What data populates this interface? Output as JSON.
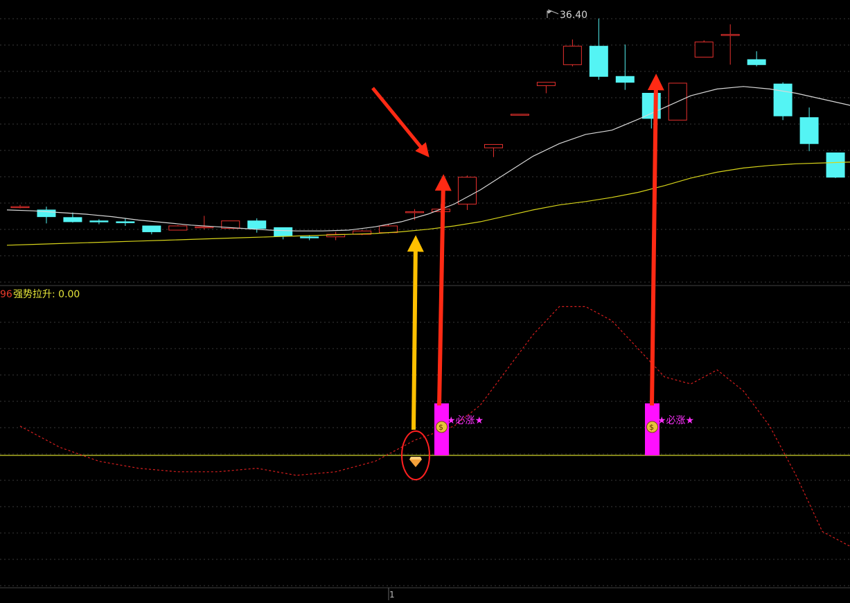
{
  "colors": {
    "background": "#000000",
    "up": "#e8312e",
    "down": "#54f4f4",
    "ma_fast": "#d8d8d8",
    "ma_slow": "#d7d41a",
    "indicator": "#d81e1e",
    "baseline": "#cfd22a",
    "signal": "#ff10ff",
    "arrow_red": "#ff2a14",
    "arrow_orange": "#ffc000",
    "grid": "#3a3a3a"
  },
  "top_panel": {
    "max_label": "36.40"
  },
  "bottom_panel": {
    "indicator_value": "96",
    "indicator_label": "强势拉升: 0.00"
  },
  "signal_label": "★必涨★",
  "axis_marker": "1",
  "chart_data": [
    {
      "type": "candlestick",
      "ylim": [
        20.5,
        37.5
      ],
      "max_annotation": 36.4,
      "candles": [
        {
          "o": 25.2,
          "h": 25.3,
          "l": 25.1,
          "c": 25.2
        },
        {
          "o": 25.0,
          "h": 25.2,
          "l": 24.2,
          "c": 24.6
        },
        {
          "o": 24.55,
          "h": 24.85,
          "l": 24.25,
          "c": 24.3
        },
        {
          "o": 24.35,
          "h": 24.45,
          "l": 24.15,
          "c": 24.3
        },
        {
          "o": 24.3,
          "h": 24.5,
          "l": 24.05,
          "c": 24.25
        },
        {
          "o": 24.05,
          "h": 24.05,
          "l": 23.55,
          "c": 23.7
        },
        {
          "o": 23.8,
          "h": 24.1,
          "l": 23.8,
          "c": 24.05
        },
        {
          "o": 23.95,
          "h": 24.65,
          "l": 23.85,
          "c": 24.0
        },
        {
          "o": 23.9,
          "h": 24.35,
          "l": 23.9,
          "c": 24.35
        },
        {
          "o": 24.35,
          "h": 24.5,
          "l": 23.65,
          "c": 23.9
        },
        {
          "o": 23.95,
          "h": 23.95,
          "l": 23.25,
          "c": 23.45
        },
        {
          "o": 23.4,
          "h": 23.5,
          "l": 23.2,
          "c": 23.35
        },
        {
          "o": 23.4,
          "h": 23.7,
          "l": 23.2,
          "c": 23.55
        },
        {
          "o": 23.55,
          "h": 23.8,
          "l": 23.5,
          "c": 23.75
        },
        {
          "o": 23.65,
          "h": 24.15,
          "l": 23.6,
          "c": 24.05
        },
        {
          "o": 24.85,
          "h": 25.05,
          "l": 24.4,
          "c": 24.9
        },
        {
          "o": 24.9,
          "h": 25.35,
          "l": 24.8,
          "c": 25.05
        },
        {
          "o": 25.35,
          "h": 27.05,
          "l": 25.0,
          "c": 26.95
        },
        {
          "o": 28.7,
          "h": 28.8,
          "l": 28.15,
          "c": 28.9
        },
        {
          "o": 30.65,
          "h": 30.7,
          "l": 30.65,
          "c": 30.7
        },
        {
          "o": 32.4,
          "h": 32.4,
          "l": 31.95,
          "c": 32.6
        },
        {
          "o": 33.65,
          "h": 35.15,
          "l": 33.55,
          "c": 34.75
        },
        {
          "o": 34.75,
          "h": 36.4,
          "l": 32.75,
          "c": 32.95
        },
        {
          "o": 32.95,
          "h": 34.85,
          "l": 32.15,
          "c": 32.6
        },
        {
          "o": 31.95,
          "h": 31.95,
          "l": 29.85,
          "c": 30.45
        },
        {
          "o": 30.35,
          "h": 32.55,
          "l": 30.35,
          "c": 32.55
        },
        {
          "o": 34.1,
          "h": 35.1,
          "l": 34.1,
          "c": 35.0
        },
        {
          "o": 35.45,
          "h": 36.05,
          "l": 33.65,
          "c": 35.45
        },
        {
          "o": 33.95,
          "h": 34.45,
          "l": 33.55,
          "c": 33.65
        },
        {
          "o": 32.5,
          "h": 32.6,
          "l": 30.35,
          "c": 30.6
        },
        {
          "o": 30.5,
          "h": 31.1,
          "l": 28.5,
          "c": 28.95
        },
        {
          "o": 28.4,
          "h": 28.4,
          "l": 26.9,
          "c": 26.95
        },
        {
          "o": 26.95,
          "h": 28.45,
          "l": 26.95,
          "c": 28.4
        },
        {
          "o": 28.2,
          "h": 28.2,
          "l": 27.3,
          "c": 27.45
        }
      ],
      "ma_fast": [
        25.0,
        24.95,
        24.85,
        24.75,
        24.6,
        24.4,
        24.25,
        24.1,
        24.0,
        23.9,
        23.8,
        23.75,
        23.75,
        23.8,
        24.0,
        24.3,
        24.75,
        25.35,
        26.2,
        27.2,
        28.2,
        28.95,
        29.5,
        29.75,
        30.4,
        31.1,
        31.8,
        32.2,
        32.35,
        32.2,
        31.95,
        31.6,
        31.25,
        30.8,
        30.6
      ],
      "ma_slow": [
        22.9,
        22.95,
        23.0,
        23.05,
        23.1,
        23.15,
        23.2,
        23.25,
        23.3,
        23.35,
        23.4,
        23.45,
        23.5,
        23.55,
        23.6,
        23.7,
        23.85,
        24.05,
        24.3,
        24.65,
        25.0,
        25.3,
        25.5,
        25.75,
        26.05,
        26.45,
        26.9,
        27.25,
        27.5,
        27.65,
        27.75,
        27.8,
        27.85,
        27.85,
        27.85
      ]
    },
    {
      "type": "line",
      "series": [
        {
          "x": [
            0,
            1.5,
            3,
            4.5,
            6,
            7.5,
            9,
            10.5,
            12,
            13.5,
            15,
            16.5,
            17.5,
            18.5,
            19.5,
            20.5,
            21.5,
            22.5,
            23.5,
            24.5,
            25.5,
            26.5,
            27.5,
            28.5,
            29.5,
            30.5,
            31.5,
            32
          ],
          "values": [
            3,
            0,
            -2,
            -3,
            -3.5,
            -3.5,
            -3,
            -4,
            -3.5,
            -2,
            1,
            3,
            6,
            11,
            16,
            20,
            20,
            18,
            14,
            10,
            9,
            11,
            8,
            3,
            -4,
            -12,
            -14,
            -14
          ]
        }
      ],
      "baseline": 0,
      "signals": [
        17.5,
        26.5
      ],
      "orange_signal": 16.5,
      "ylim": [
        -20,
        23
      ]
    }
  ]
}
